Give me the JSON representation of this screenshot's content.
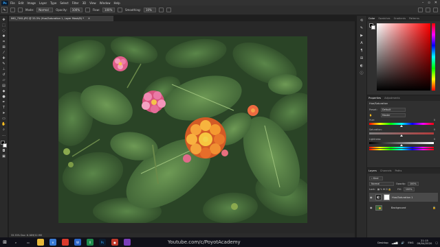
{
  "menubar": {
    "logo": "Ps",
    "items": [
      "File",
      "Edit",
      "Image",
      "Layer",
      "Type",
      "Select",
      "Filter",
      "3D",
      "View",
      "Window",
      "Help"
    ]
  },
  "options": {
    "mode_label": "Mode:",
    "mode_value": "Normal",
    "opacity_label": "Opacity:",
    "opacity_value": "100%",
    "flow_label": "Flow:",
    "flow_value": "100%",
    "smoothing_label": "Smoothing:",
    "smoothing_value": "10%"
  },
  "document": {
    "tab_title": "IMG_7361.JPG @ 33.3% (Hue/Saturation 1, Layer Mask/8) *",
    "status": "33.33%     Doc: 6.18M/12.9M"
  },
  "color_panel": {
    "tabs": [
      "Color",
      "Swatches",
      "Gradients",
      "Patterns"
    ],
    "active_tab": 0
  },
  "properties": {
    "tabs": [
      "Properties",
      "Adjustments"
    ],
    "active_tab": 0,
    "header": "Hue/Saturation",
    "preset_label": "Preset:",
    "preset_value": "Default",
    "channel_value": "Master",
    "hue_label": "Hue:",
    "hue_value": "0",
    "saturation_label": "Saturation:",
    "saturation_value": "0",
    "lightness_label": "Lightness:",
    "lightness_value": "0",
    "hue_position": 0.5,
    "saturation_position": 0.5,
    "lightness_position": 0.5
  },
  "layers_panel": {
    "tabs": [
      "Layers",
      "Channels",
      "Paths"
    ],
    "active_tab": 0,
    "blend_mode": "Normal",
    "opacity_label": "Opacity:",
    "opacity_value": "100%",
    "lock_label": "Lock:",
    "fill_label": "Fill:",
    "fill_value": "100%",
    "layers": [
      {
        "name": "Hue/Saturation 1",
        "selected": true,
        "type": "adjustment"
      },
      {
        "name": "Background",
        "selected": false,
        "type": "image"
      }
    ]
  },
  "taskbar": {
    "watermark": "Youtube.com/c/PoyotAcademy",
    "desktop_label": "Desktop",
    "language": "ENG",
    "time": "21:15",
    "date": "09/04/2020"
  },
  "colors": {
    "leaf_dark": "#2f4a2b",
    "flower_orange": "#f59a2b",
    "flower_pink": "#e8628f",
    "ui_panel": "#303030"
  }
}
